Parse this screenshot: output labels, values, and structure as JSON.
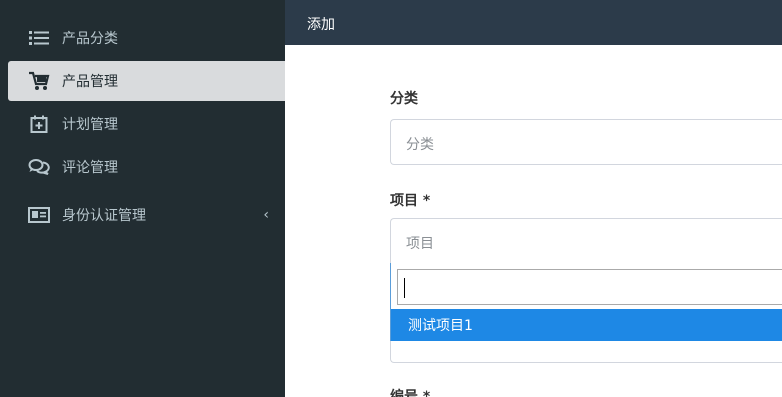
{
  "sidebar": {
    "items": [
      {
        "label": "产品分类",
        "icon": "list-icon"
      },
      {
        "label": "产品管理",
        "icon": "cart-icon"
      },
      {
        "label": "计划管理",
        "icon": "calendar-plus-icon"
      },
      {
        "label": "评论管理",
        "icon": "comments-icon"
      },
      {
        "label": "身份认证管理",
        "icon": "id-card-icon"
      }
    ],
    "chevron": "‹"
  },
  "header": {
    "title": "添加"
  },
  "form": {
    "category_label": "分类",
    "category_placeholder": "分类",
    "project_label": "项目 *",
    "project_placeholder": "项目",
    "dropdown_option": "测试项目1",
    "number_label": "编号 *"
  },
  "colors": {
    "sidebar_bg": "#222d32",
    "header_bg": "#2c3b4a",
    "highlight": "#1e88e5"
  }
}
